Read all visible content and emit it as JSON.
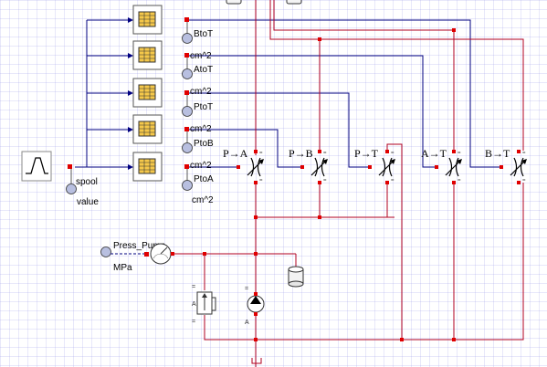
{
  "signal_labels": [
    "BtoT",
    "AtoT",
    "PtoT",
    "PtoB",
    "PtoA"
  ],
  "area_units": [
    "cm^2",
    "cm^2",
    "cm^2",
    "cm^2",
    "cm^2"
  ],
  "input_labels": {
    "spool": "spool",
    "value": "value"
  },
  "valve_labels": [
    "P→A",
    "P→B",
    "P→T",
    "A→T",
    "B→T"
  ],
  "pressure": {
    "name": "Press_Pump",
    "unit": "MPa"
  },
  "colors": {
    "signal": "#000080",
    "hydraulic": "#b00020",
    "port": "#e00000",
    "block_border": "#444444",
    "table_fill": "#f5c84a"
  }
}
